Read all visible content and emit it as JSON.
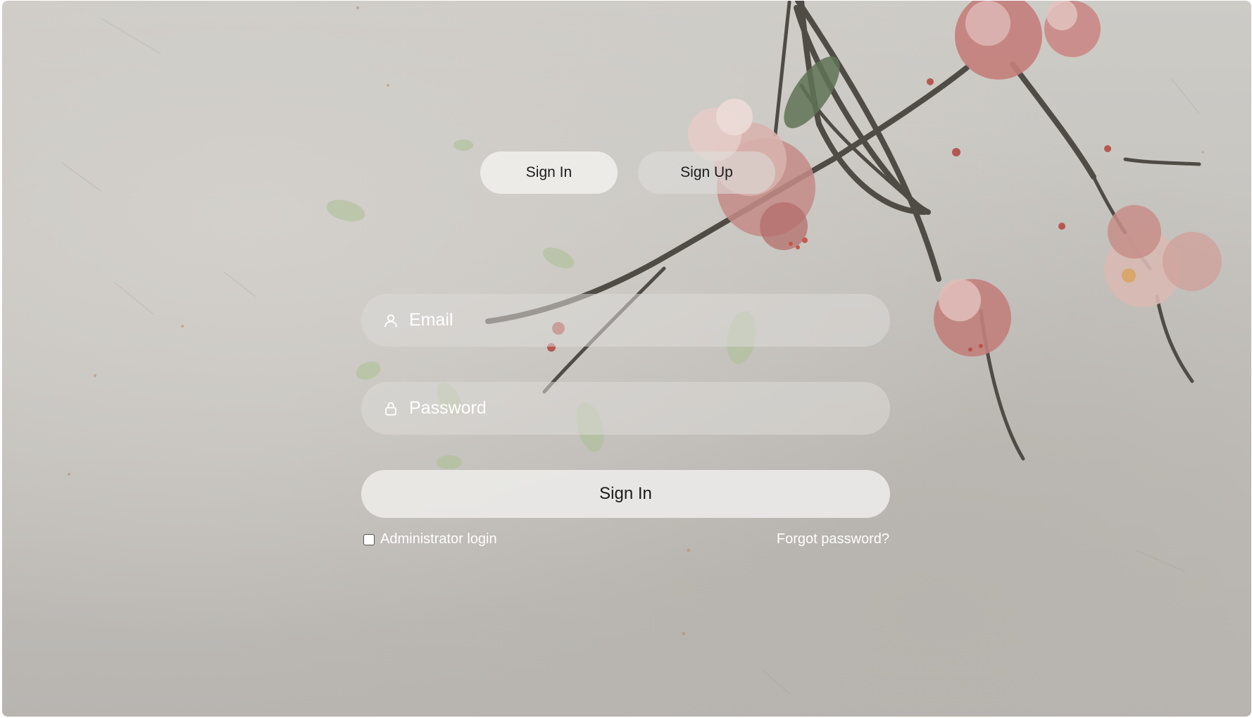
{
  "tabs": {
    "sign_in_label": "Sign In",
    "sign_up_label": "Sign Up",
    "active": "sign_in"
  },
  "form": {
    "email_placeholder": "Email",
    "email_value": "",
    "password_placeholder": "Password",
    "password_value": "",
    "submit_label": "Sign In",
    "admin_login_label": "Administrator login",
    "admin_login_checked": false,
    "forgot_password_label": "Forgot password?"
  },
  "icons": {
    "email": "user-icon",
    "password": "lock-icon"
  },
  "background": {
    "description_tag": "plum-blossom-branch-artwork"
  },
  "colors": {
    "background": "#c4c2bd",
    "field_fill": "#dcdad7",
    "button_fill": "#eae9e7",
    "text_light": "#ffffff",
    "text_dark": "#1c1c1c",
    "blossom": "#c98a86"
  }
}
